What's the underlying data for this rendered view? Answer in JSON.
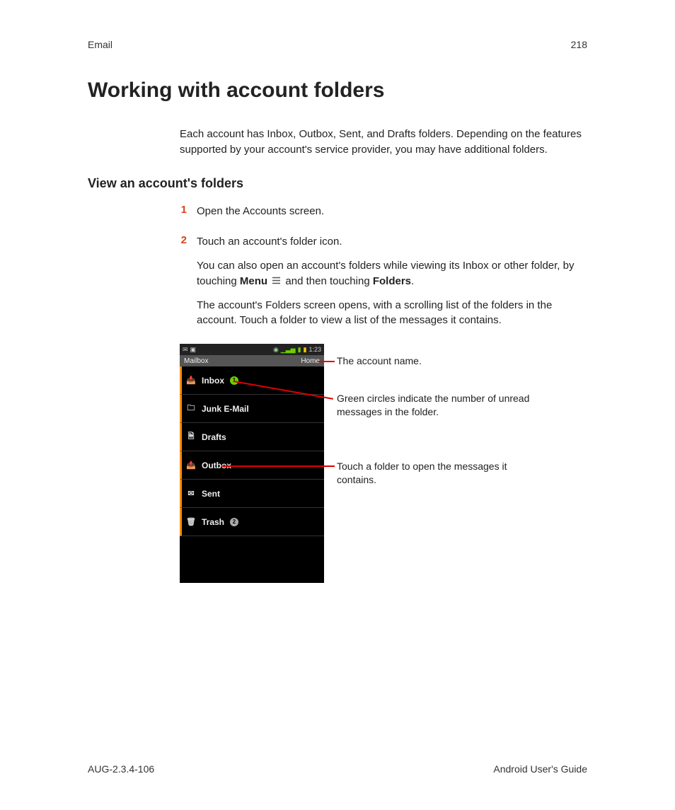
{
  "header": {
    "section": "Email",
    "page_number": "218"
  },
  "title": "Working with account folders",
  "intro": "Each account has Inbox, Outbox, Sent, and Drafts folders. Depending on the features supported by your account's service provider, you may have additional folders.",
  "section_heading": "View an account's folders",
  "steps": {
    "s1_num": "1",
    "s1_text": "Open the Accounts screen.",
    "s2_num": "2",
    "s2_text": "Touch an account's folder icon.",
    "s2_detail_pre": "You can also open an account's folders while viewing its Inbox or other folder, by touching ",
    "s2_detail_menu": "Menu",
    "s2_detail_mid": " and then touching ",
    "s2_detail_folders": "Folders",
    "s2_detail_post": ".",
    "s2_result": "The account's Folders screen opens, with a scrolling list of the folders in the account. Touch a folder to view a list of the messages it contains."
  },
  "screenshot": {
    "time": "1:23",
    "title_left": "Mailbox",
    "title_right": "Home",
    "folders": {
      "inbox": "Inbox",
      "inbox_badge": "1",
      "junk": "Junk E-Mail",
      "drafts": "Drafts",
      "outbox": "Outbox",
      "sent": "Sent",
      "trash": "Trash",
      "trash_badge": "2"
    }
  },
  "callouts": {
    "c1": "The account name.",
    "c2": "Green circles indicate the number of unread messages in the folder.",
    "c3": "Touch a folder to open the messages it contains."
  },
  "footer": {
    "left": "AUG-2.3.4-106",
    "right": "Android User's Guide"
  }
}
